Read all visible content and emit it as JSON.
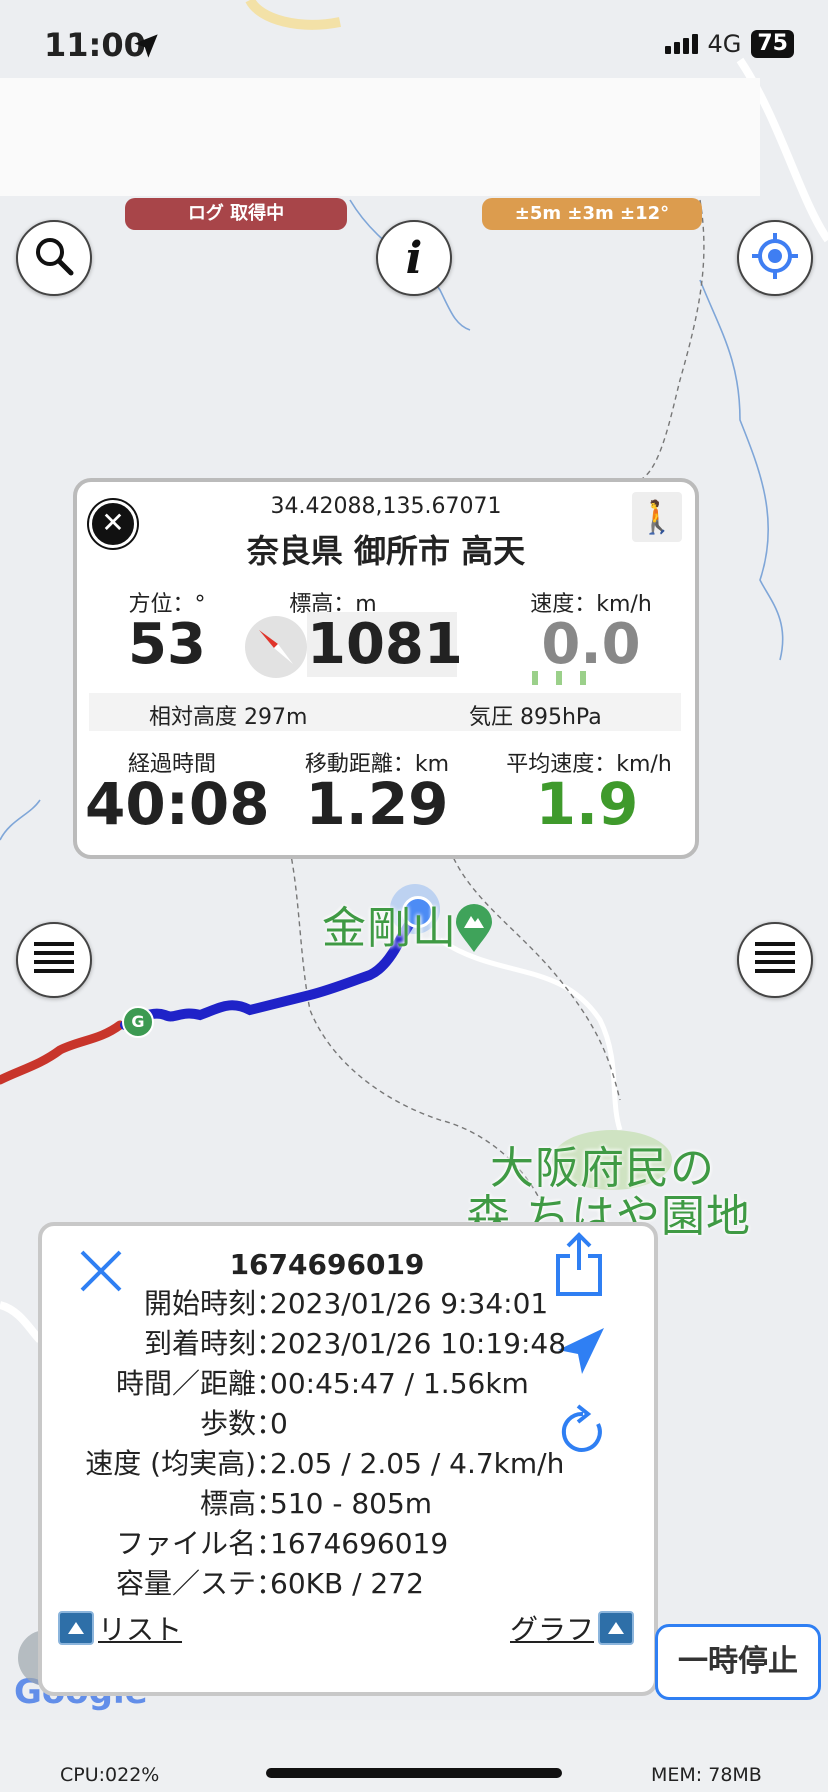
{
  "status_bar": {
    "time": "11:00",
    "network": "4G",
    "battery": "75"
  },
  "chips": {
    "log_status": "ログ 取得中",
    "accuracy": "±5m ±3m ±12°"
  },
  "map": {
    "labels": {
      "peak_name": "金剛山",
      "park_name_line1": "大阪府民の",
      "park_name_line2": "森 ちはや園地"
    },
    "google_watermark": "Google"
  },
  "info": {
    "coords": "34.42088,135.67071",
    "address": "奈良県 御所市 高天",
    "heading_label": "方位：°",
    "heading_value": "53",
    "elevation_label": "標高：m",
    "elevation_value": "1081",
    "speed_label": "速度：km/h",
    "speed_value": "0.0",
    "relative_altitude": "相対高度 297m",
    "pressure": "気圧 895hPa",
    "elapsed_label": "経過時間",
    "elapsed_value": "40:08",
    "distance_label": "移動距離：km",
    "distance_value": "1.29",
    "avg_speed_label": "平均速度：km/h",
    "avg_speed_value": "1.9"
  },
  "track": {
    "id": "1674696019",
    "rows": [
      {
        "label": "開始時刻：",
        "value": "2023/01/26 9:34:01"
      },
      {
        "label": "到着時刻：",
        "value": "2023/01/26 10:19:48"
      },
      {
        "label": "時間／距離：",
        "value": "00:45:47 / 1.56km"
      },
      {
        "label": "歩数：",
        "value": "0"
      },
      {
        "label": "速度 (均実高)：",
        "value": "2.05 / 2.05 / 4.7km/h"
      },
      {
        "label": "標高：",
        "value": "510 - 805m"
      },
      {
        "label": "ファイル名：",
        "value": "1674696019"
      },
      {
        "label": "容量／ステ：",
        "value": "60KB / 272"
      }
    ],
    "list_link": "リスト",
    "graph_link": "グラフ"
  },
  "pause_button": "一時停止",
  "footer": {
    "cpu": "CPU:022%",
    "mem": "MEM: 78MB"
  },
  "colors": {
    "accent_blue": "#2f7ff3",
    "log_chip": "#a84549",
    "accuracy_chip": "#dc9c4e",
    "avg_speed_green": "#3f9a2c",
    "track_blue": "#1f22c8",
    "track_red": "#c8352b"
  }
}
